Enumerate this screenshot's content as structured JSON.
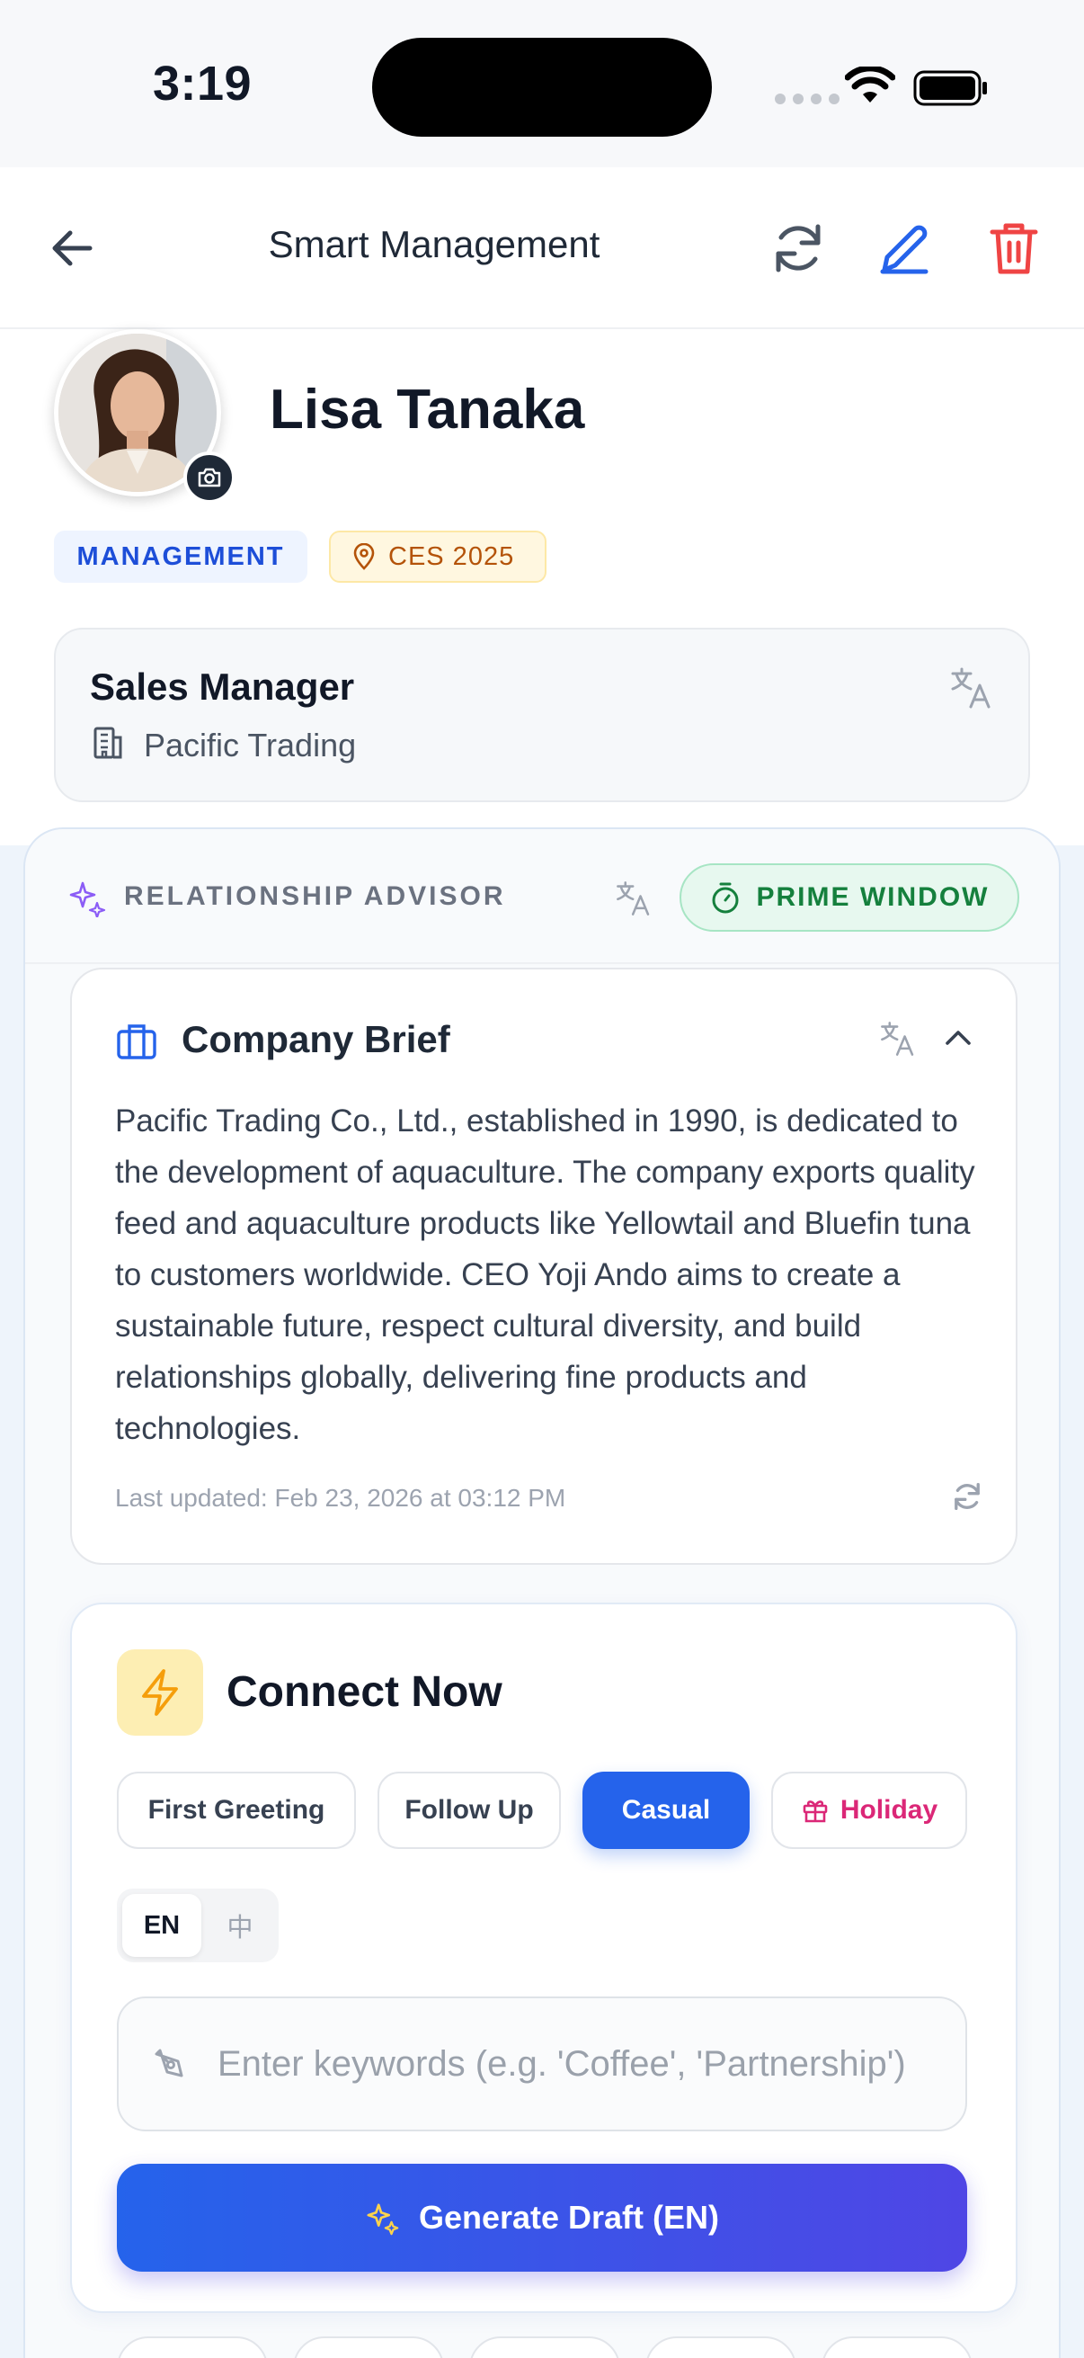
{
  "status_bar": {
    "time": "3:19"
  },
  "header": {
    "title": "Smart Management",
    "icons": {
      "back": "arrow-left-icon",
      "refresh": "refresh-icon",
      "edit": "pencil-icon",
      "delete": "trash-icon"
    },
    "colors": {
      "edit": "#2563eb",
      "delete": "#ef4444"
    }
  },
  "profile": {
    "name": "Lisa Tanaka",
    "tags": {
      "department": "MANAGEMENT",
      "event": "CES 2025"
    },
    "job_title": "Sales Manager",
    "company": "Pacific Trading"
  },
  "advisor": {
    "title": "RELATIONSHIP ADVISOR",
    "status": "PRIME WINDOW",
    "brief": {
      "title": "Company Brief",
      "body": "Pacific Trading Co., Ltd., established in 1990, is dedicated to the development of aquaculture. The company exports quality feed and aquaculture products like Yellowtail and Bluefin tuna to customers worldwide. CEO Yoji Ando aims to create a sustainable future, respect cultural diversity, and build relationships globally, delivering fine products and technologies.",
      "updated": "Last updated: Feb 23, 2026 at 03:12 PM"
    },
    "connect": {
      "title": "Connect Now",
      "chips": [
        "First Greeting",
        "Follow Up",
        "Casual",
        "Holiday"
      ],
      "selected_chip": "Casual",
      "languages": [
        "EN",
        "中"
      ],
      "selected_language": "EN",
      "input_placeholder": "Enter keywords (e.g. 'Coffee', 'Partnership')",
      "input_value": "",
      "generate_label": "Generate Draft (EN)"
    }
  },
  "colors": {
    "accent": "#2563eb",
    "prime_green": "#15803d",
    "holiday_pink": "#db2777",
    "event_amber": "#b45309"
  }
}
